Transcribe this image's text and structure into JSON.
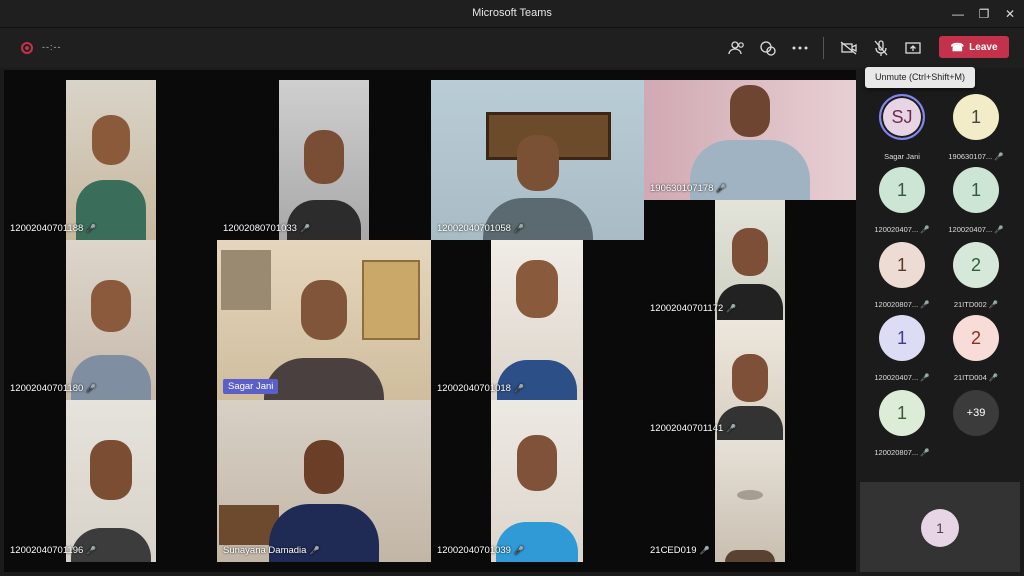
{
  "window": {
    "title": "Microsoft Teams"
  },
  "toolbar": {
    "timer": "--:--",
    "leave_label": "Leave",
    "tooltip": "Unmute (Ctrl+Shift+M)",
    "accent": "#c4314b"
  },
  "tiles": [
    {
      "name": "12002040701188"
    },
    {
      "name": "12002080701033"
    },
    {
      "name": "12002040701058"
    },
    {
      "name": "1906301071​78"
    },
    {
      "name": "12002040701180"
    },
    {
      "name": "Sagar Jani"
    },
    {
      "name": "12002040701018"
    },
    {
      "name": "12002040701172"
    },
    {
      "name": "12002040701141"
    },
    {
      "name": "12002040701196"
    },
    {
      "name": "Sunayana Damadia"
    },
    {
      "name": "12002040701039"
    },
    {
      "name": "21CED019"
    }
  ],
  "participants": [
    {
      "initials": "SJ",
      "label": "Sagar Jani"
    },
    {
      "initials": "1",
      "label": "190630107..."
    },
    {
      "initials": "1",
      "label": "120020407..."
    },
    {
      "initials": "1",
      "label": "120020407..."
    },
    {
      "initials": "1",
      "label": "120020807..."
    },
    {
      "initials": "2",
      "label": "21ITD002"
    },
    {
      "initials": "1",
      "label": "120020407..."
    },
    {
      "initials": "2",
      "label": "21ITD004"
    },
    {
      "initials": "1",
      "label": "120020807..."
    },
    {
      "initials": "+39",
      "label": ""
    }
  ],
  "self": {
    "initials": "1"
  }
}
